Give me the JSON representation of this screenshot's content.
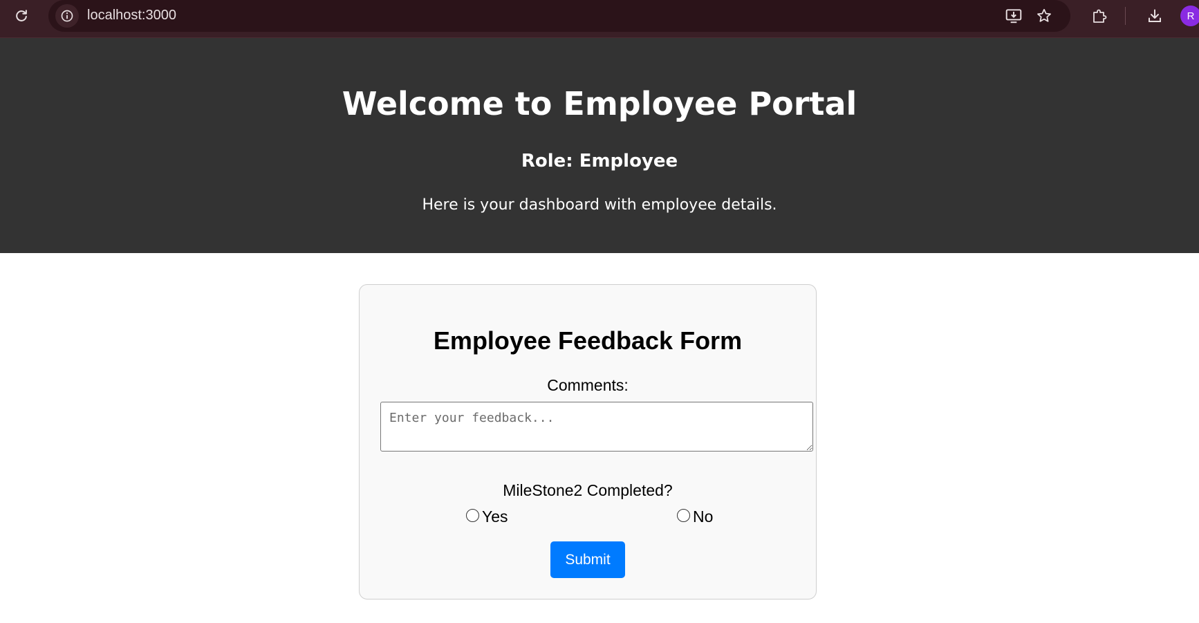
{
  "browser": {
    "url": "localhost:3000",
    "profile_initial": "R",
    "icons": [
      "reload-icon",
      "site-info-icon",
      "install-app-icon",
      "bookmark-star-icon",
      "extensions-icon",
      "download-icon"
    ]
  },
  "header": {
    "title": "Welcome to Employee Portal",
    "role": "Role: Employee",
    "description": "Here is your dashboard with employee details.",
    "background_color": "#333333"
  },
  "form": {
    "title": "Employee Feedback Form",
    "comments_label": "Comments:",
    "comments_placeholder": "Enter your feedback...",
    "comments_value": "",
    "milestone_label": "MileStone2 Completed?",
    "options": [
      {
        "label": "Yes",
        "selected": false
      },
      {
        "label": "No",
        "selected": false
      }
    ],
    "submit_label": "Submit",
    "submit_color": "#007bff"
  }
}
